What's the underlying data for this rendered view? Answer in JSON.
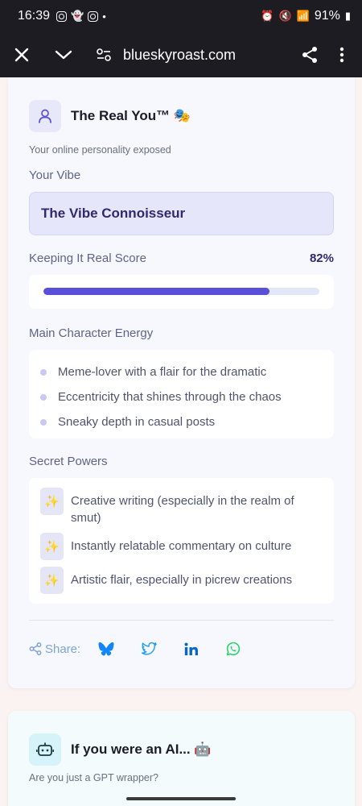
{
  "status_bar": {
    "time": "16:39",
    "battery": "91%"
  },
  "browser": {
    "url": "blueskyroast.com"
  },
  "card1": {
    "title": "The Real You™ 🎭",
    "subtitle": "Your online personality exposed",
    "vibe_label": "Your Vibe",
    "vibe_value": "The Vibe Connoisseur",
    "score_label": "Keeping It Real Score",
    "score_value": "82%",
    "score_fraction": 0.82,
    "main_character_label": "Main Character Energy",
    "main_character_items": [
      "Meme-lover with a flair for the dramatic",
      "Eccentricity that shines through the chaos",
      "Sneaky depth in casual posts"
    ],
    "secret_powers_label": "Secret Powers",
    "secret_powers": [
      "Creative writing (especially in the realm of smut)",
      "Instantly relatable commentary on culture",
      "Artistic flair, especially in picrew creations"
    ],
    "share_label": "Share:"
  },
  "card2": {
    "title": "If you were an AI... 🤖",
    "subtitle": "Are you just a GPT wrapper?"
  },
  "colors": {
    "accent": "#5a4fd8",
    "share_blue": "#7fa4d3",
    "bluesky": "#1185fe",
    "twitter": "#1d9bf0",
    "linkedin": "#0a66c2",
    "whatsapp": "#25d366"
  }
}
